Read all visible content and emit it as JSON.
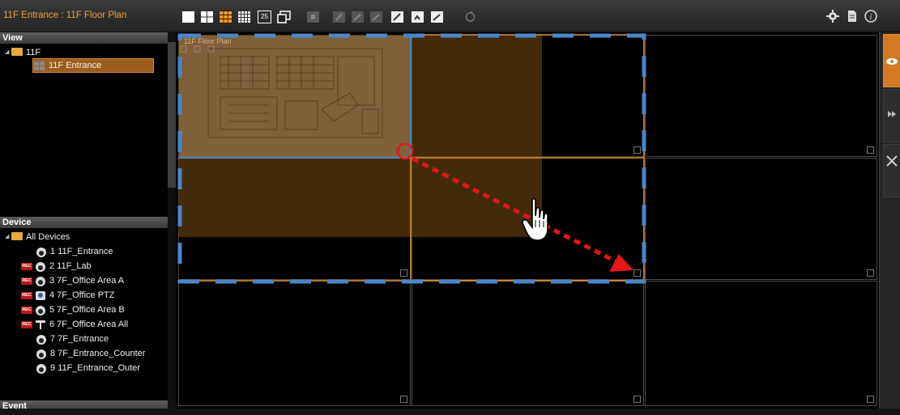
{
  "window": {
    "title": "11F Entrance : 11F Floor Plan"
  },
  "left_panel": {
    "view_header": "View",
    "view_tree": [
      {
        "label": "11F",
        "type": "folder"
      },
      {
        "label": "11F Entrance",
        "type": "view",
        "selected": true
      }
    ],
    "device_header": "Device",
    "device_tree": [
      {
        "label": "All Devices",
        "type": "folder"
      },
      {
        "label": "1 11F_Entrance",
        "rec": false,
        "icon": "dome-camera-icon"
      },
      {
        "label": "2 11F_Lab",
        "rec": true,
        "icon": "dome-camera-icon"
      },
      {
        "label": "3 7F_Office Area A",
        "rec": true,
        "icon": "dome-camera-icon"
      },
      {
        "label": "4 7F_Office PTZ",
        "rec": true,
        "icon": "ptz-camera-icon"
      },
      {
        "label": "5 7F_Office Area B",
        "rec": true,
        "icon": "dome-camera-icon"
      },
      {
        "label": "6 7F_Office Area All",
        "rec": true,
        "icon": "fisheye-camera-icon"
      },
      {
        "label": "7 7F_Entrance",
        "rec": false,
        "icon": "dome-camera-icon"
      },
      {
        "label": "8 7F_Entrance_Counter",
        "rec": false,
        "icon": "dome-camera-icon"
      },
      {
        "label": "9 11F_Entrance_Outer",
        "rec": false,
        "icon": "dome-camera-icon"
      }
    ],
    "event_header": "Event",
    "rec_badge": "REC"
  },
  "main": {
    "floor_plan_label": "11F Floor Plan",
    "toolbar_layout_25": "25"
  },
  "colors": {
    "accent": "#e8a33b",
    "selection": "#9c5e1e",
    "drag_frame": "#4a86c8",
    "arrow": "#e01818"
  }
}
